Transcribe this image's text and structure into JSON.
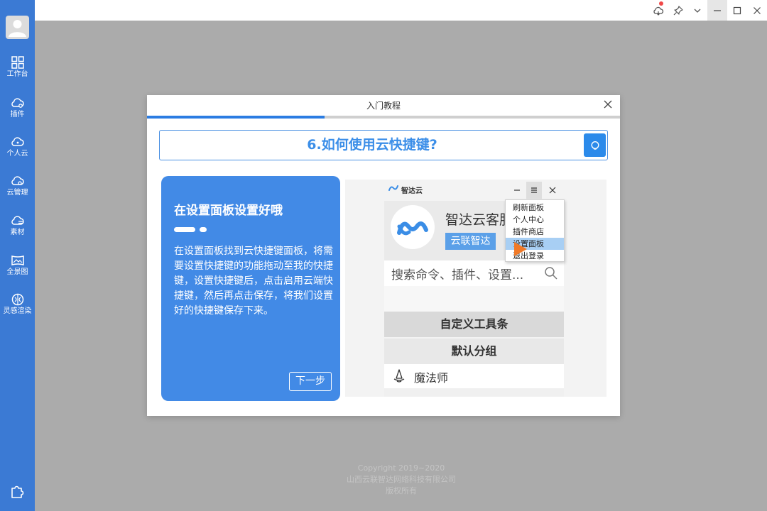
{
  "sidebar": {
    "items": [
      {
        "label": "工作台",
        "icon": "grid-icon"
      },
      {
        "label": "插件",
        "icon": "cloud-plugin-icon"
      },
      {
        "label": "个人云",
        "icon": "cloud-user-icon"
      },
      {
        "label": "云管理",
        "icon": "cloud-settings-icon"
      },
      {
        "label": "素材",
        "icon": "cloud-list-icon"
      },
      {
        "label": "全景图",
        "icon": "panorama-icon"
      },
      {
        "label": "灵感渲染",
        "icon": "brain-icon"
      }
    ],
    "bottom_icon": "puzzle-icon"
  },
  "footer": {
    "copyright": "Copyright 2019~2020",
    "company": "山西云联智达网络科技有限公司",
    "rights": "版权所有"
  },
  "dialog": {
    "title": "入门教程",
    "progress": 0.375,
    "question": "6.如何使用云快捷键?",
    "card": {
      "title": "在设置面板设置好哦",
      "description": "在设置面板找到云快捷键面板，将需要设置快捷键的功能拖动至我的快捷键，设置快捷键后，点击启用云端快捷键，然后再点击保存，将我们设置好的快捷键保存下来。",
      "next_label": "下一步"
    },
    "preview": {
      "app_name": "智达云",
      "brand": "智达云客服",
      "tag": "云联智达",
      "menu": [
        "刷新面板",
        "个人中心",
        "插件商店",
        "设置面板",
        "退出登录"
      ],
      "highlighted_menu_index": 3,
      "search_placeholder": "搜索命令、插件、设置...",
      "section1": "自定义工具条",
      "section2": "默认分组",
      "item": "魔法师"
    }
  },
  "colors": {
    "sidebar": "#3b7ad4",
    "accent": "#428ae6",
    "question_text": "#3b8ee8",
    "overlay": "#ababab"
  }
}
